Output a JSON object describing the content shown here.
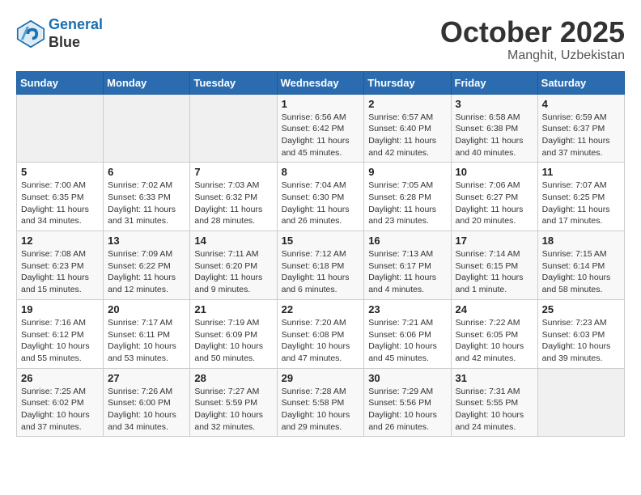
{
  "header": {
    "logo_line1": "General",
    "logo_line2": "Blue",
    "month": "October 2025",
    "location": "Manghit, Uzbekistan"
  },
  "days_of_week": [
    "Sunday",
    "Monday",
    "Tuesday",
    "Wednesday",
    "Thursday",
    "Friday",
    "Saturday"
  ],
  "weeks": [
    [
      {
        "day": "",
        "sunrise": "",
        "sunset": "",
        "daylight": ""
      },
      {
        "day": "",
        "sunrise": "",
        "sunset": "",
        "daylight": ""
      },
      {
        "day": "",
        "sunrise": "",
        "sunset": "",
        "daylight": ""
      },
      {
        "day": "1",
        "sunrise": "Sunrise: 6:56 AM",
        "sunset": "Sunset: 6:42 PM",
        "daylight": "Daylight: 11 hours and 45 minutes."
      },
      {
        "day": "2",
        "sunrise": "Sunrise: 6:57 AM",
        "sunset": "Sunset: 6:40 PM",
        "daylight": "Daylight: 11 hours and 42 minutes."
      },
      {
        "day": "3",
        "sunrise": "Sunrise: 6:58 AM",
        "sunset": "Sunset: 6:38 PM",
        "daylight": "Daylight: 11 hours and 40 minutes."
      },
      {
        "day": "4",
        "sunrise": "Sunrise: 6:59 AM",
        "sunset": "Sunset: 6:37 PM",
        "daylight": "Daylight: 11 hours and 37 minutes."
      }
    ],
    [
      {
        "day": "5",
        "sunrise": "Sunrise: 7:00 AM",
        "sunset": "Sunset: 6:35 PM",
        "daylight": "Daylight: 11 hours and 34 minutes."
      },
      {
        "day": "6",
        "sunrise": "Sunrise: 7:02 AM",
        "sunset": "Sunset: 6:33 PM",
        "daylight": "Daylight: 11 hours and 31 minutes."
      },
      {
        "day": "7",
        "sunrise": "Sunrise: 7:03 AM",
        "sunset": "Sunset: 6:32 PM",
        "daylight": "Daylight: 11 hours and 28 minutes."
      },
      {
        "day": "8",
        "sunrise": "Sunrise: 7:04 AM",
        "sunset": "Sunset: 6:30 PM",
        "daylight": "Daylight: 11 hours and 26 minutes."
      },
      {
        "day": "9",
        "sunrise": "Sunrise: 7:05 AM",
        "sunset": "Sunset: 6:28 PM",
        "daylight": "Daylight: 11 hours and 23 minutes."
      },
      {
        "day": "10",
        "sunrise": "Sunrise: 7:06 AM",
        "sunset": "Sunset: 6:27 PM",
        "daylight": "Daylight: 11 hours and 20 minutes."
      },
      {
        "day": "11",
        "sunrise": "Sunrise: 7:07 AM",
        "sunset": "Sunset: 6:25 PM",
        "daylight": "Daylight: 11 hours and 17 minutes."
      }
    ],
    [
      {
        "day": "12",
        "sunrise": "Sunrise: 7:08 AM",
        "sunset": "Sunset: 6:23 PM",
        "daylight": "Daylight: 11 hours and 15 minutes."
      },
      {
        "day": "13",
        "sunrise": "Sunrise: 7:09 AM",
        "sunset": "Sunset: 6:22 PM",
        "daylight": "Daylight: 11 hours and 12 minutes."
      },
      {
        "day": "14",
        "sunrise": "Sunrise: 7:11 AM",
        "sunset": "Sunset: 6:20 PM",
        "daylight": "Daylight: 11 hours and 9 minutes."
      },
      {
        "day": "15",
        "sunrise": "Sunrise: 7:12 AM",
        "sunset": "Sunset: 6:18 PM",
        "daylight": "Daylight: 11 hours and 6 minutes."
      },
      {
        "day": "16",
        "sunrise": "Sunrise: 7:13 AM",
        "sunset": "Sunset: 6:17 PM",
        "daylight": "Daylight: 11 hours and 4 minutes."
      },
      {
        "day": "17",
        "sunrise": "Sunrise: 7:14 AM",
        "sunset": "Sunset: 6:15 PM",
        "daylight": "Daylight: 11 hours and 1 minute."
      },
      {
        "day": "18",
        "sunrise": "Sunrise: 7:15 AM",
        "sunset": "Sunset: 6:14 PM",
        "daylight": "Daylight: 10 hours and 58 minutes."
      }
    ],
    [
      {
        "day": "19",
        "sunrise": "Sunrise: 7:16 AM",
        "sunset": "Sunset: 6:12 PM",
        "daylight": "Daylight: 10 hours and 55 minutes."
      },
      {
        "day": "20",
        "sunrise": "Sunrise: 7:17 AM",
        "sunset": "Sunset: 6:11 PM",
        "daylight": "Daylight: 10 hours and 53 minutes."
      },
      {
        "day": "21",
        "sunrise": "Sunrise: 7:19 AM",
        "sunset": "Sunset: 6:09 PM",
        "daylight": "Daylight: 10 hours and 50 minutes."
      },
      {
        "day": "22",
        "sunrise": "Sunrise: 7:20 AM",
        "sunset": "Sunset: 6:08 PM",
        "daylight": "Daylight: 10 hours and 47 minutes."
      },
      {
        "day": "23",
        "sunrise": "Sunrise: 7:21 AM",
        "sunset": "Sunset: 6:06 PM",
        "daylight": "Daylight: 10 hours and 45 minutes."
      },
      {
        "day": "24",
        "sunrise": "Sunrise: 7:22 AM",
        "sunset": "Sunset: 6:05 PM",
        "daylight": "Daylight: 10 hours and 42 minutes."
      },
      {
        "day": "25",
        "sunrise": "Sunrise: 7:23 AM",
        "sunset": "Sunset: 6:03 PM",
        "daylight": "Daylight: 10 hours and 39 minutes."
      }
    ],
    [
      {
        "day": "26",
        "sunrise": "Sunrise: 7:25 AM",
        "sunset": "Sunset: 6:02 PM",
        "daylight": "Daylight: 10 hours and 37 minutes."
      },
      {
        "day": "27",
        "sunrise": "Sunrise: 7:26 AM",
        "sunset": "Sunset: 6:00 PM",
        "daylight": "Daylight: 10 hours and 34 minutes."
      },
      {
        "day": "28",
        "sunrise": "Sunrise: 7:27 AM",
        "sunset": "Sunset: 5:59 PM",
        "daylight": "Daylight: 10 hours and 32 minutes."
      },
      {
        "day": "29",
        "sunrise": "Sunrise: 7:28 AM",
        "sunset": "Sunset: 5:58 PM",
        "daylight": "Daylight: 10 hours and 29 minutes."
      },
      {
        "day": "30",
        "sunrise": "Sunrise: 7:29 AM",
        "sunset": "Sunset: 5:56 PM",
        "daylight": "Daylight: 10 hours and 26 minutes."
      },
      {
        "day": "31",
        "sunrise": "Sunrise: 7:31 AM",
        "sunset": "Sunset: 5:55 PM",
        "daylight": "Daylight: 10 hours and 24 minutes."
      },
      {
        "day": "",
        "sunrise": "",
        "sunset": "",
        "daylight": ""
      }
    ]
  ]
}
